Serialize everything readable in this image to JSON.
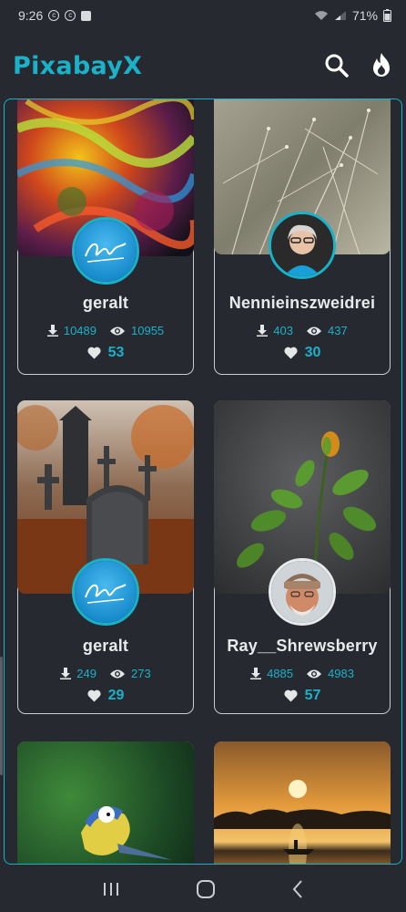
{
  "status": {
    "time": "9:26",
    "battery": "71%"
  },
  "app": {
    "title": "PixabayX"
  },
  "cards": [
    {
      "user": "geralt",
      "downloads": "10489",
      "views": "10955",
      "likes": "53"
    },
    {
      "user": "Nennieinszweidrei",
      "downloads": "403",
      "views": "437",
      "likes": "30"
    },
    {
      "user": "geralt",
      "downloads": "249",
      "views": "273",
      "likes": "29"
    },
    {
      "user": "Ray__Shrewsberry",
      "downloads": "4885",
      "views": "4983",
      "likes": "57"
    }
  ],
  "colors": {
    "accent": "#1ab1c9",
    "background": "#262a30",
    "card_border": "#c9ccd0"
  },
  "icons": {
    "search": "search-icon",
    "trending": "flame-icon",
    "download": "download-icon",
    "views": "eye-icon",
    "likes": "heart-icon",
    "nav_recents": "recents-icon",
    "nav_home": "home-icon",
    "nav_back": "back-icon"
  }
}
